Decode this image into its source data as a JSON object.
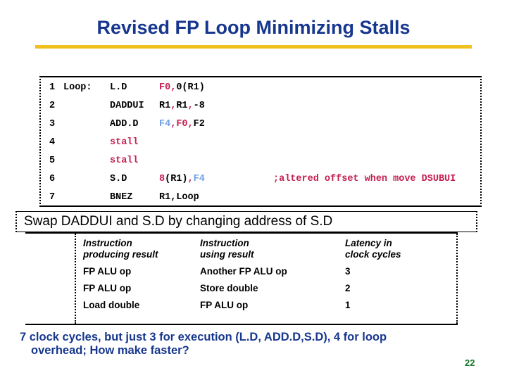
{
  "slide": {
    "title": "Revised FP Loop Minimizing Stalls",
    "page_number": "22",
    "accent_colors": {
      "title_blue": "#17378e",
      "rule_gold": "#f0c020",
      "code_crimson": "#c41e50",
      "code_skyblue": "#6f9fe8",
      "page_number_green": "#1a7a2e"
    }
  },
  "code_block": {
    "lines": [
      {
        "num": "1",
        "label": "Loop:",
        "op": "L.D",
        "arg_parts": [
          {
            "text": "F0",
            "color": "crimson"
          },
          {
            "text": ",",
            "color": "crimson"
          },
          {
            "text": "0(R1)",
            "color": "black"
          }
        ],
        "comment": ""
      },
      {
        "num": "2",
        "label": "",
        "op": "DADDUI",
        "arg_parts": [
          {
            "text": "R1",
            "color": "black"
          },
          {
            "text": ",",
            "color": "crimson"
          },
          {
            "text": "R1",
            "color": "black"
          },
          {
            "text": ",",
            "color": "crimson"
          },
          {
            "text": "-8",
            "color": "black"
          }
        ],
        "comment": ""
      },
      {
        "num": "3",
        "label": "",
        "op": "ADD.D",
        "arg_parts": [
          {
            "text": "F4",
            "color": "skyblue"
          },
          {
            "text": ",",
            "color": "crimson"
          },
          {
            "text": "F0",
            "color": "crimson"
          },
          {
            "text": ",",
            "color": "crimson"
          },
          {
            "text": "F2",
            "color": "black"
          }
        ],
        "comment": ""
      },
      {
        "num": "4",
        "label": "",
        "op": "",
        "stall": {
          "text": "stall",
          "color": "crimson"
        },
        "arg_parts": [],
        "comment": ""
      },
      {
        "num": "5",
        "label": "",
        "op": "",
        "stall": {
          "text": "stall",
          "color": "crimson"
        },
        "arg_parts": [],
        "comment": ""
      },
      {
        "num": "6",
        "label": "",
        "op": "S.D",
        "arg_parts": [
          {
            "text": "8",
            "color": "crimson"
          },
          {
            "text": "(R1)",
            "color": "black"
          },
          {
            "text": ",",
            "color": "crimson"
          },
          {
            "text": "F4",
            "color": "skyblue"
          }
        ],
        "comment": ";altered offset when move DSUBUI"
      },
      {
        "num": "7",
        "label": "",
        "op": "BNEZ",
        "arg_parts": [
          {
            "text": "R1,Loop",
            "color": "black"
          }
        ],
        "comment": ""
      }
    ]
  },
  "swap_banner": {
    "text": "Swap DADDUI and S.D by changing address of S.D"
  },
  "latency_table": {
    "headers": [
      "Instruction\nproducing result",
      "Instruction\nusing result",
      "Latency in\nclock cycles"
    ],
    "headers_lines": [
      [
        "Instruction",
        "producing result"
      ],
      [
        "Instruction",
        "using result"
      ],
      [
        "Latency in",
        "clock cycles"
      ]
    ],
    "rows": [
      [
        "FP ALU op",
        "Another FP ALU op",
        "3"
      ],
      [
        "FP ALU op",
        "Store double",
        "2"
      ],
      [
        "Load double",
        "FP ALU op",
        "1"
      ]
    ]
  },
  "footer": {
    "line1": "7 clock cycles, but just 3 for execution (L.D, ADD.D,S.D), 4 for loop",
    "line2": "overhead; How make  faster?"
  }
}
